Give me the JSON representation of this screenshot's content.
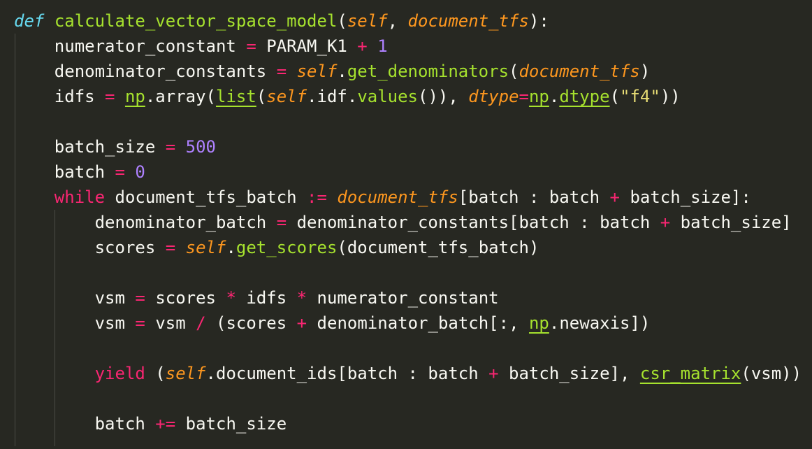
{
  "code": {
    "line1": {
      "def": "def",
      "func": "calculate_vector_space_model",
      "p1": "(",
      "self": "self",
      "p2": ", ",
      "arg": "document_tfs",
      "p3": "):"
    },
    "line2": {
      "var": "numerator_constant",
      "eq": "=",
      "const": "PARAM_K1",
      "plus": "+",
      "num": "1"
    },
    "line3": {
      "var": "denominator_constants",
      "eq": "=",
      "self": "self",
      "dot": ".",
      "meth": "get_denominators",
      "p1": "(",
      "arg": "document_tfs",
      "p2": ")"
    },
    "line4": {
      "var": "idfs",
      "eq": "=",
      "np": "np",
      "dot1": ".array(",
      "list": "list",
      "p1": "(",
      "self": "self",
      "rest": ".idf.",
      "values": "values",
      "p2": "()), ",
      "dtype_kw": "dtype",
      "eq2": "=",
      "np2": "np",
      "dot2": ".",
      "dtype_fn": "dtype",
      "p3": "(",
      "str": "\"f4\"",
      "p4": "))"
    },
    "line6": {
      "var": "batch_size",
      "eq": "=",
      "num": "500"
    },
    "line7": {
      "var": "batch",
      "eq": "=",
      "num": "0"
    },
    "line8": {
      "kw": "while",
      "var": "document_tfs_batch",
      "walrus": ":=",
      "arg": "document_tfs",
      "s1": "[batch : batch ",
      "plus": "+",
      "s2": " batch_size]:"
    },
    "line9": {
      "var": "denominator_batch",
      "eq": "=",
      "s1": "denominator_constants[batch : batch ",
      "plus": "+",
      "s2": " batch_size]"
    },
    "line10": {
      "var": "scores",
      "eq": "=",
      "self": "self",
      "dot": ".",
      "meth": "get_scores",
      "rest": "(document_tfs_batch)"
    },
    "line12": {
      "var": "vsm",
      "eq": "=",
      "a": "scores",
      "m1": "*",
      "b": "idfs",
      "m2": "*",
      "c": "numerator_constant"
    },
    "line13": {
      "var": "vsm",
      "eq": "=",
      "a": "vsm",
      "div": "/",
      "b": "(scores",
      "plus": "+",
      "c": "denominator_batch[:, ",
      "np": "np",
      "d": ".newaxis])"
    },
    "line15": {
      "kw": "yield",
      "p1": "(",
      "self": "self",
      "s1": ".document_ids[batch : batch ",
      "plus": "+",
      "s2": " batch_size], ",
      "csr": "csr_matrix",
      "s3": "(vsm))"
    },
    "line17": {
      "var": "batch",
      "op": "+=",
      "rest": "batch_size"
    }
  }
}
